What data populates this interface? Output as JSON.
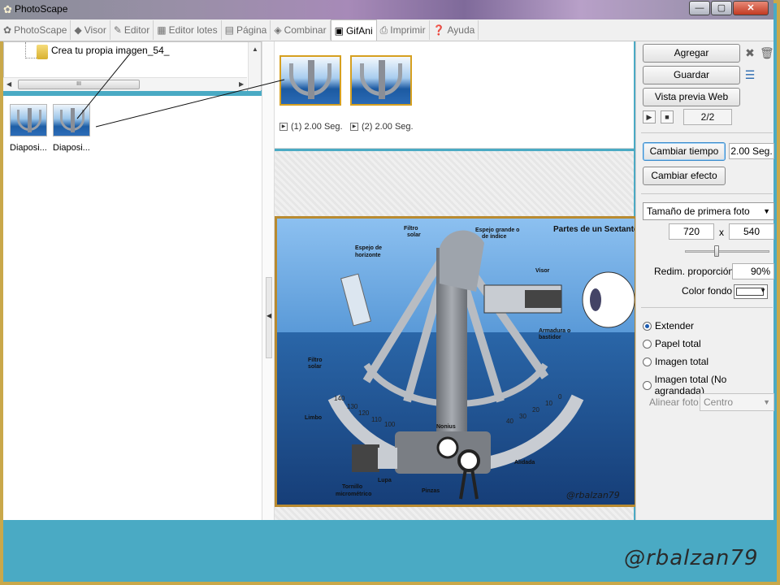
{
  "window": {
    "title": "PhotoScape",
    "controls": {
      "minimize": "—",
      "maximize": "▢",
      "close": "✕"
    }
  },
  "tabs": [
    {
      "label": "PhotoScape",
      "icon": "photoscape-icon"
    },
    {
      "label": "Visor",
      "icon": "viewer-icon"
    },
    {
      "label": "Editor",
      "icon": "editor-icon"
    },
    {
      "label": "Editor lotes",
      "icon": "batch-editor-icon"
    },
    {
      "label": "Página",
      "icon": "page-icon"
    },
    {
      "label": "Combinar",
      "icon": "combine-icon"
    },
    {
      "label": "GifAni",
      "icon": "gifani-icon",
      "active": true
    },
    {
      "label": "Imprimir",
      "icon": "print-icon"
    },
    {
      "label": "Ayuda",
      "icon": "help-icon"
    }
  ],
  "tree": {
    "folder_label": "Crea tu propia imagen_54_",
    "hscroll_grip": "III"
  },
  "files": [
    {
      "label": "Diaposi..."
    },
    {
      "label": "Diaposi..."
    }
  ],
  "frames": [
    {
      "caption": "(1) 2.00 Seg."
    },
    {
      "caption": "(2) 2.00 Seg."
    }
  ],
  "preview": {
    "title": "Partes de un Sextante",
    "labels": {
      "filtro_solar_top": [
        "Filtro",
        "solar"
      ],
      "espejo_grande": [
        "Espejo grande o",
        "de índice"
      ],
      "espejo_horizonte": [
        "Espejo de",
        "horizonte"
      ],
      "visor": "Visor",
      "armadura": [
        "Armadura o",
        "bastidor"
      ],
      "filtro_solar_left": [
        "Filtro",
        "solar"
      ],
      "limbo": "Limbo",
      "nonius": "Nonius",
      "alidada": "Alidada",
      "lupa": "Lupa",
      "pinzas": "Pinzas",
      "tornillo": [
        "Tornillo",
        "micrométrico"
      ]
    },
    "scale_ticks": [
      "140",
      "130",
      "120",
      "110",
      "100",
      "40",
      "30",
      "20",
      "10",
      "0"
    ],
    "credit": "@rbalzan79"
  },
  "right_panel": {
    "agregar": "Agregar",
    "guardar": "Guardar",
    "vista_previa_web": "Vista previa Web",
    "frame_counter": "2/2",
    "cambiar_tiempo": "Cambiar tiempo",
    "tiempo_value": "2.00 Seg.",
    "cambiar_efecto": "Cambiar efecto",
    "size_mode": "Tamaño de primera foto",
    "width": "720",
    "x_sep": "x",
    "height": "540",
    "resize_ratio_label": "Redim. proporción",
    "resize_ratio_value": "90%",
    "bg_color_label": "Color fondo",
    "radio_options": [
      {
        "label": "Extender",
        "selected": true
      },
      {
        "label": "Papel total",
        "selected": false
      },
      {
        "label": "Imagen total",
        "selected": false
      },
      {
        "label": "Imagen total (No agrandada)",
        "selected": false
      }
    ],
    "align_label": "Alinear foto",
    "align_value": "Centro"
  },
  "watermark": "@rbalzan79",
  "colors": {
    "slide_background": "#4aaac4",
    "frame_border": "#c9a84a",
    "thumb_selection": "#d6a020",
    "sea_top": "#6aa4dc",
    "sea_bottom": "#1a4e8e"
  }
}
